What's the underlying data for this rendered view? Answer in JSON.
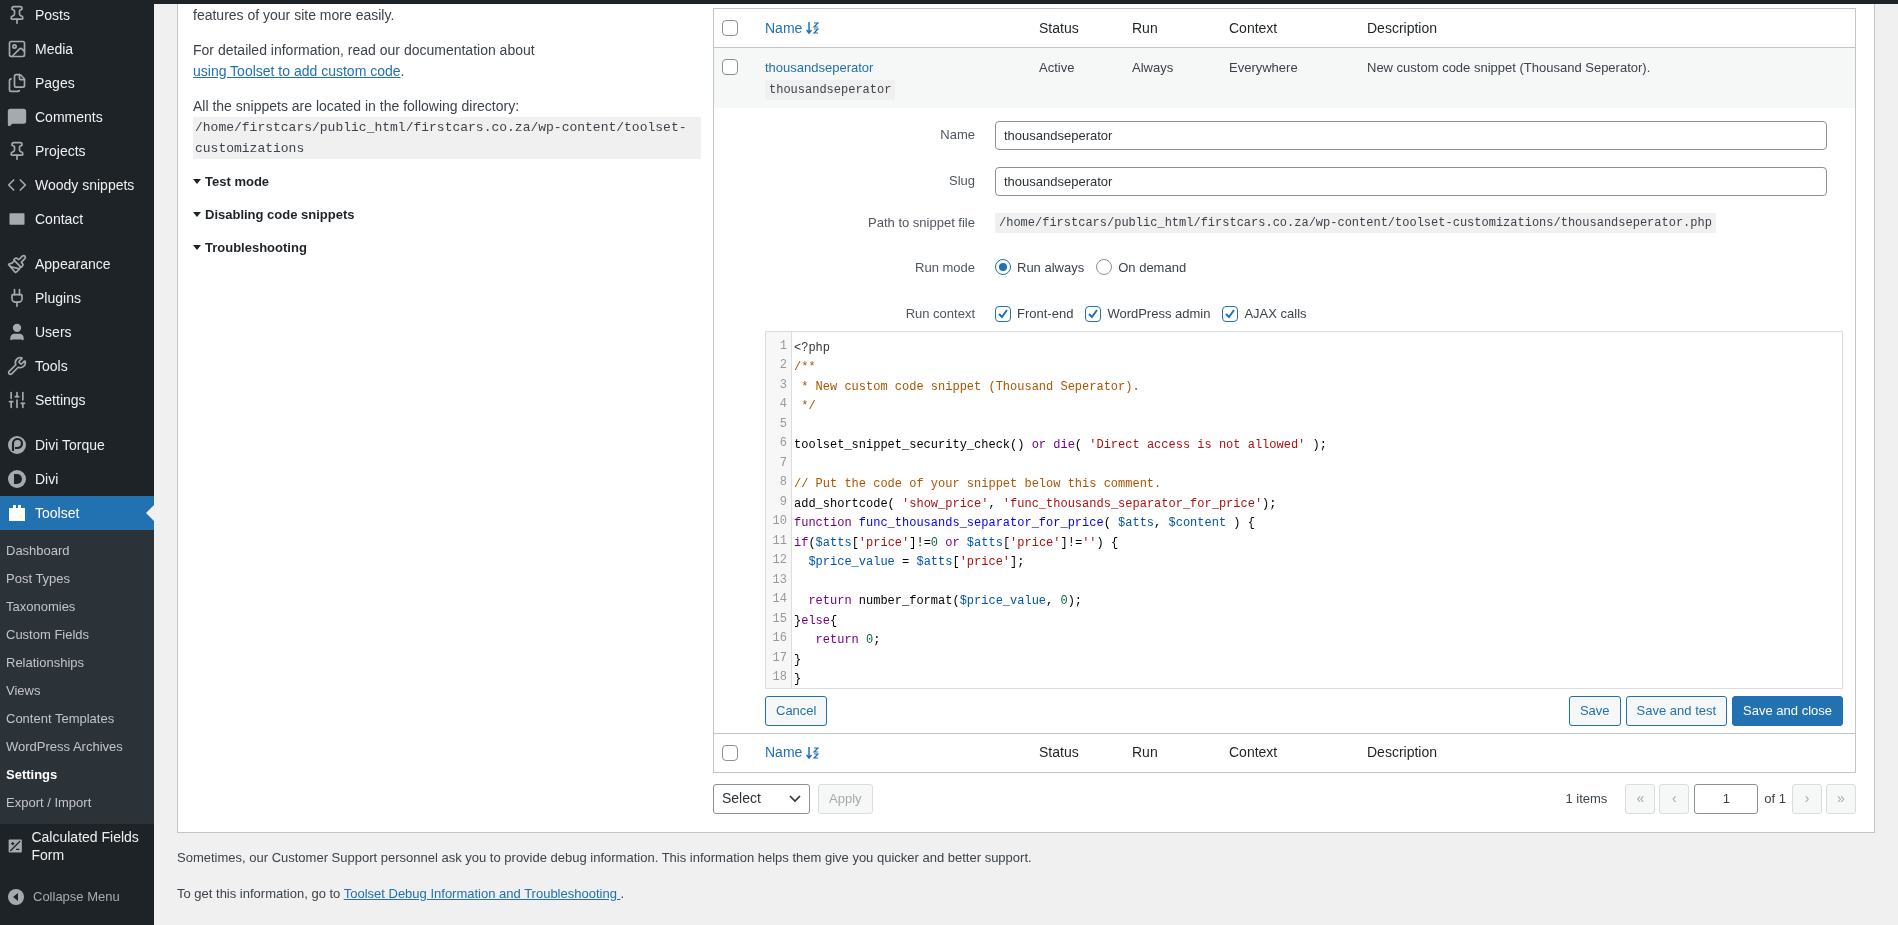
{
  "sidebar": {
    "sections": [
      {
        "items": [
          {
            "label": "Posts",
            "selected": false
          },
          {
            "label": "Media",
            "selected": false
          },
          {
            "label": "Pages",
            "selected": false
          },
          {
            "label": "Comments",
            "selected": false
          },
          {
            "label": "Projects",
            "selected": false
          },
          {
            "label": "Woody snippets",
            "selected": false
          },
          {
            "label": "Contact",
            "selected": false
          }
        ]
      },
      {
        "items": [
          {
            "label": "Appearance",
            "selected": false
          },
          {
            "label": "Plugins",
            "selected": false
          },
          {
            "label": "Users",
            "selected": false
          },
          {
            "label": "Tools",
            "selected": false
          },
          {
            "label": "Settings",
            "selected": false
          }
        ]
      },
      {
        "items": [
          {
            "label": "Divi Torque",
            "selected": false
          },
          {
            "label": "Divi",
            "selected": false
          },
          {
            "label": "Toolset",
            "selected": true,
            "submenu": [
              {
                "label": "Dashboard",
                "selected": false
              },
              {
                "label": "Post Types",
                "selected": false
              },
              {
                "label": "Taxonomies",
                "selected": false
              },
              {
                "label": "Custom Fields",
                "selected": false
              },
              {
                "label": "Relationships",
                "selected": false
              },
              {
                "label": "Views",
                "selected": false
              },
              {
                "label": "Content Templates",
                "selected": false
              },
              {
                "label": "WordPress Archives",
                "selected": false
              },
              {
                "label": "Settings",
                "selected": true
              },
              {
                "label": "Export / Import",
                "selected": false
              }
            ]
          },
          {
            "label": "Calculated Fields Form",
            "selected": false
          }
        ]
      }
    ],
    "collapse_label": "Collapse Menu"
  },
  "info": {
    "intro_tail": "features of your site more easily.",
    "doc_text": "For detailed information, read our documentation about ",
    "doc_link": "using Toolset to add custom code",
    "doc_end": ".",
    "dir_text": "All the snippets are located in the following directory:",
    "dir_path": "/home/firstcars/public_html/firstcars.co.za/wp-content/toolset-customizations",
    "toggles": [
      {
        "label": "Test mode",
        "expanded": false
      },
      {
        "label": "Disabling code snippets",
        "expanded": false
      },
      {
        "label": "Troubleshooting",
        "expanded": false
      }
    ]
  },
  "table": {
    "select_all_checked": false,
    "columns": [
      "Name",
      "Status",
      "Run",
      "Context",
      "Description"
    ],
    "rows": [
      {
        "checked": false,
        "name": "thousandseperator",
        "slug": "thousandseperator",
        "status": "Active",
        "run": "Always",
        "context": "Everywhere",
        "description": "New custom code snippet (Thousand Seperator)."
      }
    ],
    "footer_select_all_checked": false,
    "footer_columns": [
      "Name",
      "Status",
      "Run",
      "Context",
      "Description"
    ]
  },
  "editor": {
    "name_label": "Name",
    "name_value": "thousandseperator",
    "slug_label": "Slug",
    "slug_value": "thousandseperator",
    "path_label": "Path to snippet file",
    "path_value": "/home/firstcars/public_html/firstcars.co.za/wp-content/toolset-customizations/thousandseperator.php",
    "run_mode_label": "Run mode",
    "run_modes": [
      {
        "label": "Run always",
        "selected": true
      },
      {
        "label": "On demand",
        "selected": false
      }
    ],
    "run_context_label": "Run context",
    "run_contexts": [
      {
        "label": "Front-end",
        "checked": true
      },
      {
        "label": "WordPress admin",
        "checked": true
      },
      {
        "label": "AJAX calls",
        "checked": true
      }
    ],
    "code_lines": [
      {
        "number": "1",
        "tokens": [
          {
            "text": "<?php",
            "kind": "meta"
          }
        ]
      },
      {
        "number": "2",
        "tokens": [
          {
            "text": "/**",
            "kind": "comment"
          }
        ]
      },
      {
        "number": "3",
        "tokens": [
          {
            "text": " * New custom code snippet (Thousand Seperator).",
            "kind": "comment"
          }
        ]
      },
      {
        "number": "4",
        "tokens": [
          {
            "text": " */",
            "kind": "comment"
          }
        ]
      },
      {
        "number": "5"
      },
      {
        "number": "6",
        "tokens": [
          {
            "text": "toolset_snippet_security_check() ",
            "kind": "plain"
          },
          {
            "text": "or",
            "kind": "keyword"
          },
          {
            "text": " die",
            "kind": "keyword"
          },
          {
            "text": "( ",
            "kind": "plain"
          },
          {
            "text": "'Direct access is not allowed'",
            "kind": "string"
          },
          {
            "text": " );",
            "kind": "plain"
          }
        ]
      },
      {
        "number": "7"
      },
      {
        "number": "8",
        "tokens": [
          {
            "text": "// Put the code of your snippet below this comment.",
            "kind": "comment"
          }
        ]
      },
      {
        "number": "9",
        "tokens": [
          {
            "text": "add_shortcode( ",
            "kind": "plain"
          },
          {
            "text": "'show_price'",
            "kind": "string"
          },
          {
            "text": ", ",
            "kind": "plain"
          },
          {
            "text": "'func_thousands_separator_for_price'",
            "kind": "string"
          },
          {
            "text": ");",
            "kind": "plain"
          }
        ]
      },
      {
        "number": "10",
        "tokens": [
          {
            "text": "function",
            "kind": "keyword"
          },
          {
            "text": " func_thousands_separator_for_price",
            "kind": "def"
          },
          {
            "text": "( ",
            "kind": "plain"
          },
          {
            "text": "$atts",
            "kind": "variable"
          },
          {
            "text": ", ",
            "kind": "plain"
          },
          {
            "text": "$content",
            "kind": "variable"
          },
          {
            "text": " ) {",
            "kind": "plain"
          }
        ]
      },
      {
        "number": "11",
        "tokens": [
          {
            "text": "if",
            "kind": "keyword"
          },
          {
            "text": "(",
            "kind": "plain"
          },
          {
            "text": "$atts",
            "kind": "variable"
          },
          {
            "text": "[",
            "kind": "plain"
          },
          {
            "text": "'price'",
            "kind": "string"
          },
          {
            "text": "]!=",
            "kind": "plain"
          },
          {
            "text": "0",
            "kind": "number"
          },
          {
            "text": " or",
            "kind": "keyword"
          },
          {
            "text": " $atts",
            "kind": "variable"
          },
          {
            "text": "[",
            "kind": "plain"
          },
          {
            "text": "'price'",
            "kind": "string"
          },
          {
            "text": "]!=",
            "kind": "plain"
          },
          {
            "text": "''",
            "kind": "string"
          },
          {
            "text": ") {",
            "kind": "plain"
          }
        ]
      },
      {
        "number": "12",
        "tokens": [
          {
            "text": "  $price_value",
            "kind": "variable"
          },
          {
            "text": " = ",
            "kind": "plain"
          },
          {
            "text": "$atts",
            "kind": "variable"
          },
          {
            "text": "[",
            "kind": "plain"
          },
          {
            "text": "'price'",
            "kind": "string"
          },
          {
            "text": "];",
            "kind": "plain"
          }
        ]
      },
      {
        "number": "13"
      },
      {
        "number": "14",
        "tokens": [
          {
            "text": "  return",
            "kind": "keyword"
          },
          {
            "text": " number_format(",
            "kind": "plain"
          },
          {
            "text": "$price_value",
            "kind": "variable"
          },
          {
            "text": ", ",
            "kind": "plain"
          },
          {
            "text": "0",
            "kind": "number"
          },
          {
            "text": ");",
            "kind": "plain"
          }
        ]
      },
      {
        "number": "15",
        "tokens": [
          {
            "text": "}",
            "kind": "plain"
          },
          {
            "text": "else",
            "kind": "keyword"
          },
          {
            "text": "{",
            "kind": "plain"
          }
        ]
      },
      {
        "number": "16",
        "tokens": [
          {
            "text": "   return",
            "kind": "keyword"
          },
          {
            "text": " 0",
            "kind": "number"
          },
          {
            "text": ";",
            "kind": "plain"
          }
        ]
      },
      {
        "number": "17",
        "tokens": [
          {
            "text": "}",
            "kind": "plain"
          }
        ]
      },
      {
        "number": "18",
        "tokens": [
          {
            "text": "}",
            "kind": "plain"
          }
        ]
      }
    ],
    "cancel": "Cancel",
    "save": "Save",
    "save_test": "Save and test",
    "save_close": "Save and close"
  },
  "bulk": {
    "select": "Select",
    "apply": "Apply",
    "apply_disabled": true
  },
  "pagination": {
    "count": "1 items",
    "first": {
      "label": "«",
      "disabled": true
    },
    "prev": {
      "label": "‹",
      "disabled": true
    },
    "page": "1",
    "of": "of 1",
    "next": {
      "label": "›",
      "disabled": true
    },
    "last": {
      "label": "»",
      "disabled": true
    }
  },
  "footer": {
    "support_text": "Sometimes, our Customer Support personnel ask you to provide debug information. This information helps them give you quicker and better support.",
    "goto_text": "To get this information, go to ",
    "goto_link": "Toolset Debug Information and Troubleshooting ",
    "goto_end": "."
  }
}
